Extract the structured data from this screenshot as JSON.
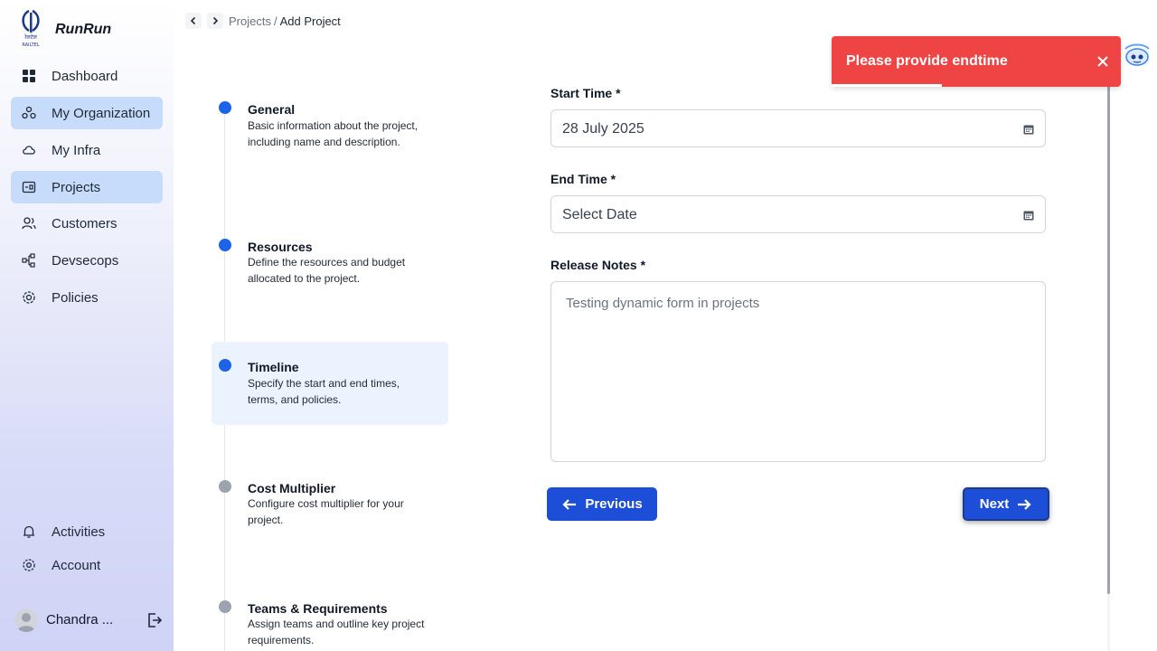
{
  "app": {
    "name": "RunRun",
    "logo_text": "रेलटेल RAILTEL"
  },
  "sidebar": {
    "items": [
      {
        "label": "Dashboard",
        "icon": "grid-icon",
        "active": false
      },
      {
        "label": "My Organization",
        "icon": "organization-icon",
        "active": true
      },
      {
        "label": "My Infra",
        "icon": "cloud-icon",
        "active": false
      },
      {
        "label": "Projects",
        "icon": "project-icon",
        "active": true
      },
      {
        "label": "Customers",
        "icon": "users-icon",
        "active": false
      },
      {
        "label": "Devsecops",
        "icon": "pipeline-icon",
        "active": false
      },
      {
        "label": "Policies",
        "icon": "shield-gear-icon",
        "active": false
      }
    ],
    "bottom": [
      {
        "label": "Activities",
        "icon": "bell-icon"
      },
      {
        "label": "Account",
        "icon": "gear-icon"
      }
    ],
    "user": {
      "name": "Chandra ..."
    }
  },
  "breadcrumb": {
    "parent": "Projects",
    "separator": "/",
    "current": "Add Project"
  },
  "steps": [
    {
      "title": "General",
      "desc": "Basic information about the project, including name and description.",
      "state": "done"
    },
    {
      "title": "Resources",
      "desc": "Define the resources and budget allocated to the project.",
      "state": "done"
    },
    {
      "title": "Timeline",
      "desc": "Specify the start and end times, terms, and policies.",
      "state": "active"
    },
    {
      "title": "Cost Multiplier",
      "desc": "Configure cost multiplier for your project.",
      "state": "pending"
    },
    {
      "title": "Teams & Requirements",
      "desc": "Assign teams and outline key project requirements.",
      "state": "pending"
    }
  ],
  "form": {
    "start_time": {
      "label": "Start Time *",
      "value": "28 July 2025"
    },
    "end_time": {
      "label": "End Time *",
      "placeholder": "Select Date"
    },
    "release_notes": {
      "label": "Release Notes *",
      "value": "Testing dynamic form in projects"
    }
  },
  "buttons": {
    "previous": "Previous",
    "next": "Next"
  },
  "toast": {
    "message": "Please provide endtime",
    "color": "#ef4444"
  },
  "colors": {
    "accent": "#1d4ed8",
    "active_dot": "#1d63e8",
    "pending_dot": "#9ca3af",
    "active_nav": "#c7dcfb"
  }
}
